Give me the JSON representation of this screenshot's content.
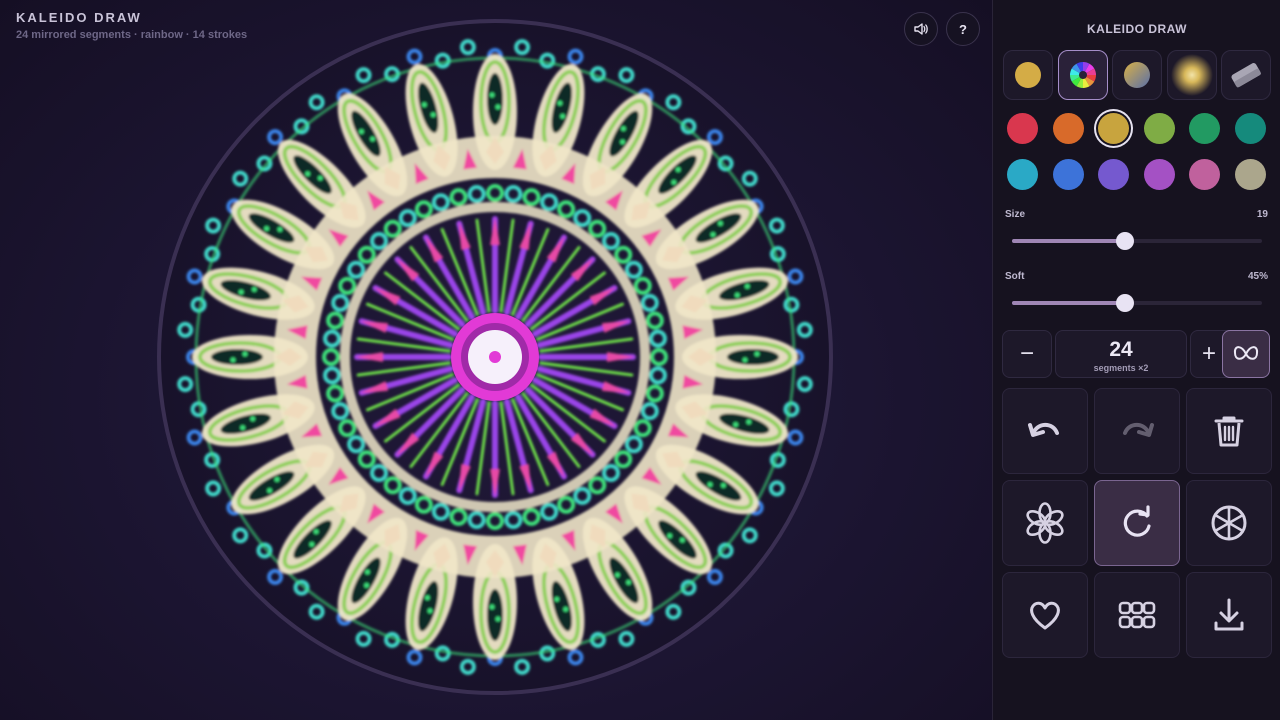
{
  "header": {
    "title": "KALEIDO DRAW",
    "subtitle": "24 mirrored segments · rainbow · 14 strokes",
    "sound_icon": "speaker-icon",
    "help_label": "?"
  },
  "panel": {
    "title": "KALEIDO DRAW",
    "brushes": [
      {
        "name": "solid",
        "icon": "solid-dot-icon",
        "active": false
      },
      {
        "name": "rainbow",
        "icon": "rainbow-wheel-icon",
        "active": true
      },
      {
        "name": "gradient",
        "icon": "gradient-dot-icon",
        "active": false
      },
      {
        "name": "glow",
        "icon": "glow-icon",
        "active": false
      },
      {
        "name": "eraser",
        "icon": "eraser-icon",
        "active": false
      }
    ],
    "palette": [
      {
        "color": "#d9374e",
        "selected": false
      },
      {
        "color": "#d86a2a",
        "selected": false
      },
      {
        "color": "#c8a43e",
        "selected": true
      },
      {
        "color": "#7fac45",
        "selected": false
      },
      {
        "color": "#229a62",
        "selected": false
      },
      {
        "color": "#158a7c",
        "selected": false
      },
      {
        "color": "#2aa9c6",
        "selected": false
      },
      {
        "color": "#3d73d9",
        "selected": false
      },
      {
        "color": "#7559cf",
        "selected": false
      },
      {
        "color": "#a451c4",
        "selected": false
      },
      {
        "color": "#c0619d",
        "selected": false
      },
      {
        "color": "#aba68c",
        "selected": false
      }
    ],
    "size": {
      "label": "Size",
      "value": "19",
      "fraction": 0.45
    },
    "soft": {
      "label": "Soft",
      "value": "45%",
      "fraction": 0.45
    },
    "segments": {
      "minus": "−",
      "plus": "+",
      "count": "24",
      "caption": "segments ×2",
      "mirror_icon": "butterfly-mirror-icon"
    },
    "tools": [
      {
        "name": "undo",
        "icon": "undo-icon",
        "enabled": true
      },
      {
        "name": "redo",
        "icon": "redo-icon",
        "enabled": false
      },
      {
        "name": "clear",
        "icon": "trash-icon",
        "enabled": true
      },
      {
        "name": "flower",
        "icon": "flower-icon",
        "enabled": true
      },
      {
        "name": "auto-rotate",
        "icon": "rotate-icon",
        "enabled": true,
        "active": true
      },
      {
        "name": "wheel",
        "icon": "wheel-icon",
        "enabled": true
      },
      {
        "name": "heart",
        "icon": "heart-icon",
        "enabled": true
      },
      {
        "name": "tiles",
        "icon": "tiles-icon",
        "enabled": true
      },
      {
        "name": "download",
        "icon": "download-icon",
        "enabled": true
      }
    ]
  },
  "canvas": {
    "segments": 24,
    "stroke_count": 14,
    "mode": "rainbow",
    "colors": {
      "petal": "#efe6c8",
      "petal_vein": "#8fcf5a",
      "petal_core": "#0e2a26",
      "ring_teal": "#3fd6c8",
      "ring_blue": "#3a82e6",
      "ring_green": "#3ee07a",
      "spoke_purple": "#9a45e8",
      "spoke_green": "#6ee04a",
      "accent_pink": "#f04aa0",
      "accent_orange": "#f07a5a",
      "hub_magenta": "#e23ad6"
    }
  }
}
